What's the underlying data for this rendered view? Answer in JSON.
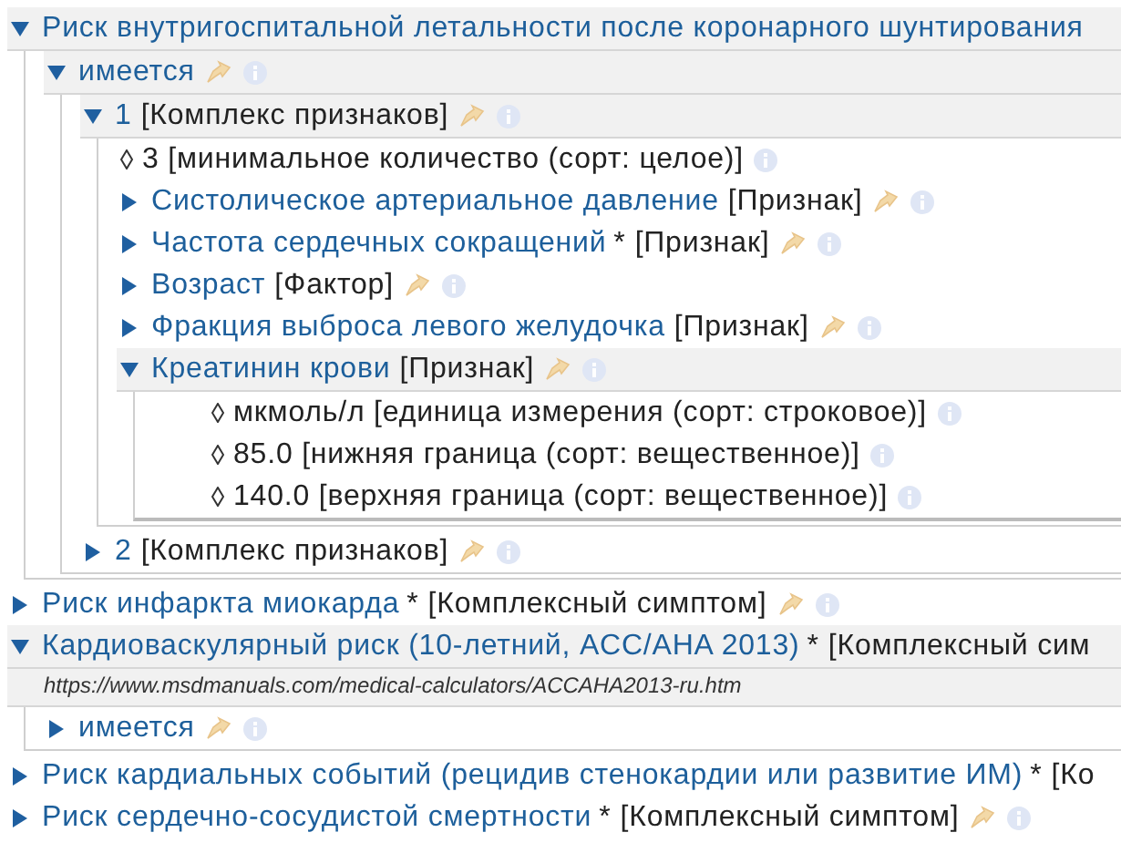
{
  "tree": [
    {
      "kind": "concept",
      "name": "Риск внутригоспитальной летальности после коронарного шунтирования",
      "expanded": true,
      "edit": false,
      "info": false,
      "children": [
        {
          "kind": "concept",
          "name": "имеется",
          "expanded": true,
          "edit": true,
          "info": true,
          "children": [
            {
              "kind": "concept",
              "name": "1",
              "type": "[Комплекс признаков]",
              "expanded": true,
              "edit": true,
              "info": true,
              "children": [
                {
                  "kind": "value",
                  "text": "3 [минимальное количество (сорт: целое)]",
                  "info": true
                },
                {
                  "kind": "concept",
                  "name": "Систолическое артериальное давление",
                  "type": "[Признак]",
                  "expanded": false,
                  "edit": true,
                  "info": true
                },
                {
                  "kind": "concept",
                  "name": "Частота сердечных сокращений",
                  "mark": "*",
                  "type": "[Признак]",
                  "expanded": false,
                  "edit": true,
                  "info": true
                },
                {
                  "kind": "concept",
                  "name": "Возраст",
                  "type": "[Фактор]",
                  "expanded": false,
                  "edit": true,
                  "info": true
                },
                {
                  "kind": "concept",
                  "name": "Фракция выброса левого желудочка",
                  "type": "[Признак]",
                  "expanded": false,
                  "edit": true,
                  "info": true
                },
                {
                  "kind": "concept",
                  "name": "Креатинин крови",
                  "type": "[Признак]",
                  "expanded": true,
                  "edit": true,
                  "info": true,
                  "children": [
                    {
                      "kind": "value",
                      "text": "мкмоль/л [единица измерения (сорт: строковое)]",
                      "info": true
                    },
                    {
                      "kind": "value",
                      "text": "85.0 [нижняя граница (сорт: вещественное)]",
                      "info": true
                    },
                    {
                      "kind": "value",
                      "text": "140.0 [верхняя граница (сорт: вещественное)]",
                      "info": true
                    }
                  ]
                }
              ]
            },
            {
              "kind": "concept",
              "name": "2",
              "type": "[Комплекс признаков]",
              "expanded": false,
              "edit": true,
              "info": true
            }
          ]
        }
      ]
    },
    {
      "kind": "concept",
      "name": "Риск инфаркта миокарда",
      "mark": "*",
      "type": "[Комплексный симптом]",
      "expanded": false,
      "edit": true,
      "info": true
    },
    {
      "kind": "concept",
      "name": "Кардиоваскулярный риск (10-летний, ACC/AHA 2013)",
      "mark": "*",
      "type": "[Комплексный сим",
      "url": "https://www.msdmanuals.com/medical-calculators/ACCAHA2013-ru.htm",
      "expanded": true,
      "edit": false,
      "info": false,
      "children": [
        {
          "kind": "concept",
          "name": "имеется",
          "expanded": false,
          "edit": true,
          "info": true
        }
      ]
    },
    {
      "kind": "concept",
      "name": "Риск кардиальных событий (рецидив стенокардии или развитие ИМ)",
      "mark": "*",
      "type": "[Ко",
      "expanded": false,
      "edit": false,
      "info": false
    },
    {
      "kind": "concept",
      "name": "Риск сердечно-сосудистой смертности",
      "mark": "*",
      "type": "[Комплексный симптом]",
      "expanded": false,
      "edit": true,
      "info": true
    }
  ]
}
